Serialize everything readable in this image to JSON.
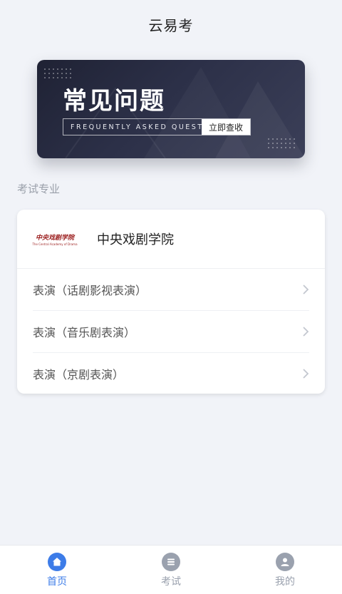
{
  "header": {
    "title": "云易考"
  },
  "banner": {
    "title": "常见问题",
    "subtitle": "FREQUENTLY ASKED QUESTION",
    "button": "立即查收"
  },
  "section": {
    "label": "考试专业"
  },
  "school": {
    "name": "中央戏剧学院",
    "logo_text": "中央戏剧学院",
    "logo_subtext": "The Central Academy of Drama"
  },
  "majors": [
    {
      "label": "表演（话剧影视表演）"
    },
    {
      "label": "表演（音乐剧表演）"
    },
    {
      "label": "表演（京剧表演）"
    }
  ],
  "tabbar": {
    "items": [
      {
        "label": "首页",
        "icon": "home-icon",
        "active": true
      },
      {
        "label": "考试",
        "icon": "exam-list-icon",
        "active": false
      },
      {
        "label": "我的",
        "icon": "user-icon",
        "active": false
      }
    ]
  },
  "colors": {
    "accent": "#3d7ce8",
    "inactive": "#9aa1ae",
    "banner_dark": "#23263a",
    "logo_red": "#9a1b1b"
  }
}
